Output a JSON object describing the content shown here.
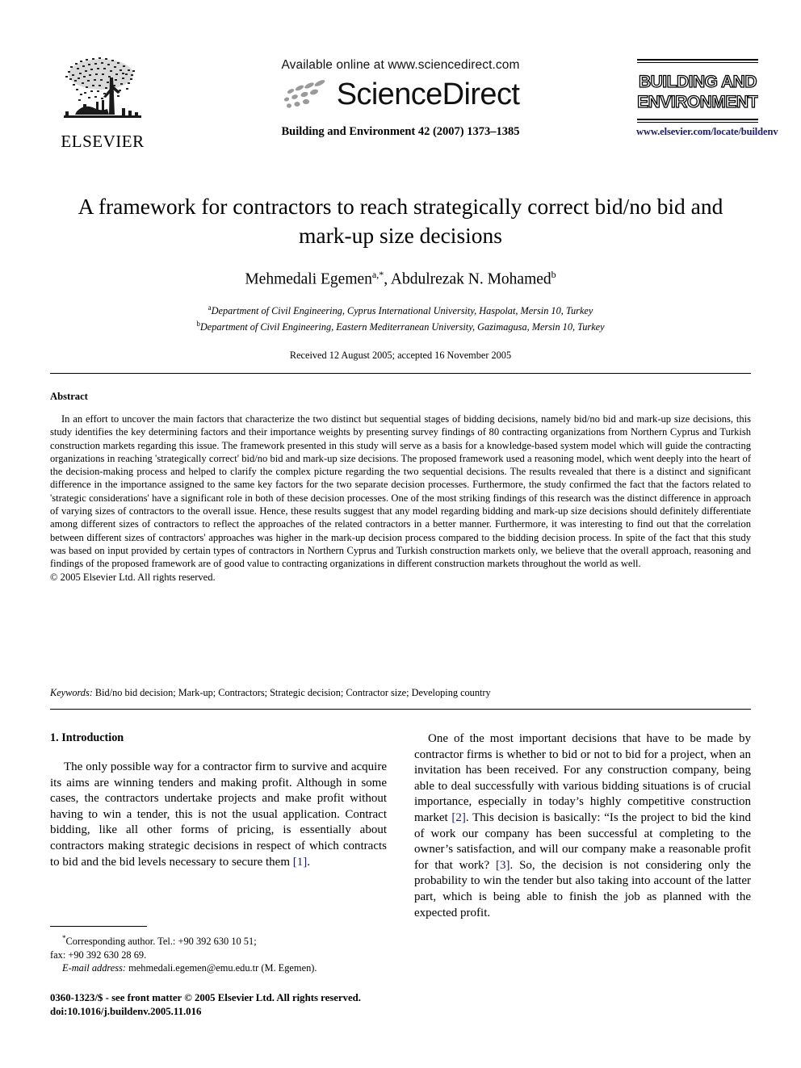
{
  "masthead": {
    "publisher_name": "ELSEVIER",
    "available_online": "Available online at www.sciencedirect.com",
    "sciencedirect_word": "ScienceDirect",
    "journal_citation": "Building and Environment 42 (2007) 1373–1385",
    "journal_logo_line1": "BUILDING AND",
    "journal_logo_line2": "ENVIRONMENT",
    "journal_url": "www.elsevier.com/locate/buildenv"
  },
  "article": {
    "title": "A framework for contractors to reach strategically correct bid/no bid and mark-up size decisions",
    "authors_html": "Mehmedali Egemen<sup>a,*</sup>, Abdulrezak N. Mohamed<sup>b</sup>",
    "affiliation_a": "Department of Civil Engineering, Cyprus International University, Haspolat, Mersin 10, Turkey",
    "affiliation_b": "Department of Civil Engineering, Eastern Mediterranean University, Gazimagusa, Mersin 10, Turkey",
    "history": "Received 12 August 2005; accepted 16 November 2005"
  },
  "abstract": {
    "heading": "Abstract",
    "text": "In an effort to uncover the main factors that characterize the two distinct but sequential stages of bidding decisions, namely bid/no bid and mark-up size decisions, this study identifies the key determining factors and their importance weights by presenting survey findings of 80 contracting organizations from Northern Cyprus and Turkish construction markets regarding this issue. The framework presented in this study will serve as a basis for a knowledge-based system model which will guide the contracting organizations in reaching 'strategically correct' bid/no bid and mark-up size decisions. The proposed framework used a reasoning model, which went deeply into the heart of the decision-making process and helped to clarify the complex picture regarding the two sequential decisions. The results revealed that there is a distinct and significant difference in the importance assigned to the same key factors for the two separate decision processes. Furthermore, the study confirmed the fact that the factors related to 'strategic considerations' have a significant role in both of these decision processes. One of the most striking findings of this research was the distinct difference in approach of varying sizes of contractors to the overall issue. Hence, these results suggest that any model regarding bidding and mark-up size decisions should definitely differentiate among different sizes of contractors to reflect the approaches of the related contractors in a better manner. Furthermore, it was interesting to find out that the correlation between different sizes of contractors' approaches was higher in the mark-up decision process compared to the bidding decision process. In spite of the fact that this study was based on input provided by certain types of contractors in Northern Cyprus and Turkish construction markets only, we believe that the overall approach, reasoning and findings of the proposed framework are of good value to contracting organizations in different construction markets throughout the world as well.",
    "copyright": "© 2005 Elsevier Ltd. All rights reserved.",
    "keywords_label": "Keywords:",
    "keywords_text": "Bid/no bid decision; Mark-up; Contractors; Strategic decision; Contractor size; Developing country"
  },
  "introduction": {
    "heading": "1. Introduction",
    "left_paragraph_part1": "The only possible way for a contractor firm to survive and acquire its aims are winning tenders and making profit. Although in some cases, the contractors undertake projects and make profit without having to win a tender, this is not the usual application. Contract bidding, like all other forms of pricing, is essentially about contractors making strategic decisions in respect of which contracts to bid and the bid levels necessary to secure them ",
    "left_ref1": "[1]",
    "left_paragraph_part2": ".",
    "right_part1": "One of the most important decisions that have to be made by contractor firms is whether to bid or not to bid for a project, when an invitation has been received. For any construction company, being able to deal successfully with various bidding situations is of crucial importance, especially in today’s highly competitive construction market ",
    "right_ref2": "[2]",
    "right_part2": ". This decision is basically: “Is the project to bid the kind of work our company has been successful at completing to the owner’s satisfaction, and will our company make a reasonable profit for that work? ",
    "right_ref3": "[3]",
    "right_part3": ". So, the decision is not considering only the probability to win the tender but also taking into account of the latter part, which is being able to finish the job as planned with the expected profit."
  },
  "footnotes": {
    "corresponding_author": "Corresponding author. Tel.: +90 392 630 10 51;",
    "fax_line": "fax: +90 392 630 28 69.",
    "email_label": "E-mail address:",
    "email_value": "mehmedali.egemen@emu.edu.tr (M. Egemen).",
    "front_matter": "0360-1323/$ - see front matter © 2005 Elsevier Ltd. All rights reserved.",
    "doi": "doi:10.1016/j.buildenv.2005.11.016"
  },
  "colors": {
    "link_navy": "#1b1b6f",
    "text_black": "#000000",
    "swoosh_grey": "#9a9a9a",
    "page_background": "#ffffff"
  }
}
